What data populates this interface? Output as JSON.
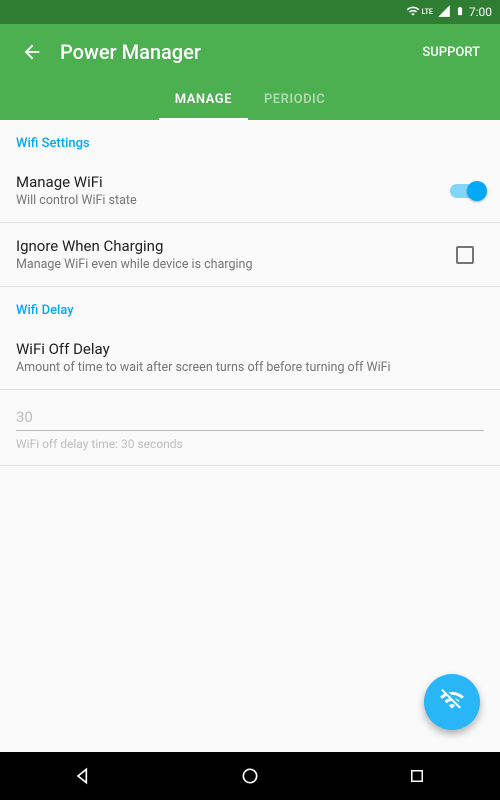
{
  "status": {
    "time": "7:00",
    "lte": "LTE"
  },
  "appbar": {
    "title": "Power Manager",
    "support": "SUPPORT"
  },
  "tabs": {
    "manage": "MANAGE",
    "periodic": "PERIODIC"
  },
  "sections": {
    "wifiSettings": {
      "header": "Wifi Settings",
      "manageWifi": {
        "title": "Manage WiFi",
        "sub": "Will control WiFi state"
      },
      "ignoreCharging": {
        "title": "Ignore When Charging",
        "sub": "Manage WiFi even while device is charging"
      }
    },
    "wifiDelay": {
      "header": "Wifi Delay",
      "offDelay": {
        "title": "WiFi Off Delay",
        "sub": "Amount of time to wait after screen turns off before turning off WiFi"
      },
      "input": "30",
      "caption": "WiFi off delay time: 30 seconds"
    }
  }
}
